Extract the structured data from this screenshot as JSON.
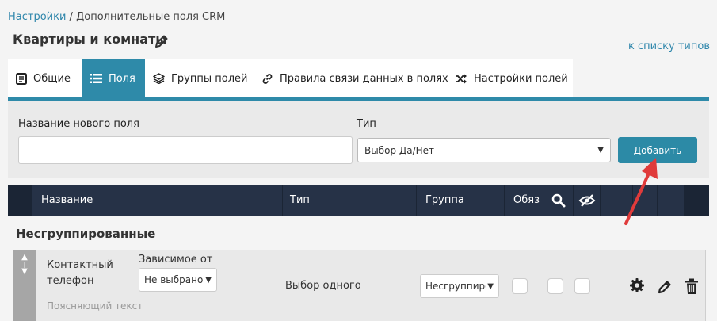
{
  "breadcrumb": {
    "root": "Настройки",
    "separator": " / ",
    "current": "Дополнительные поля CRM"
  },
  "page": {
    "title": "Квартиры и комнаты",
    "back_link": "к списку типов"
  },
  "tabs": [
    {
      "label": "Общие",
      "icon": "document-icon",
      "active": false
    },
    {
      "label": "Поля",
      "icon": "list-icon",
      "active": true
    },
    {
      "label": "Группы полей",
      "icon": "layers-icon",
      "active": false
    },
    {
      "label": "Правила связи данных в полях",
      "icon": "link-icon",
      "active": false
    },
    {
      "label": "Настройки полей",
      "icon": "shuffle-icon",
      "active": false
    }
  ],
  "add_form": {
    "name_label": "Название нового поля",
    "name_value": "",
    "type_label": "Тип",
    "type_value": "Выбор Да/Нет",
    "add_button": "Добавить"
  },
  "table": {
    "headers": {
      "name": "Название",
      "type": "Тип",
      "group": "Группа",
      "required": "Обяз"
    },
    "header_icons": [
      "search-icon",
      "eye-off-icon"
    ]
  },
  "groups": [
    {
      "title": "Несгруппированные",
      "rows": [
        {
          "name": "Контактный телефон",
          "dependent_label": "Зависимое от",
          "dependent_value": "Не выбрано",
          "hint_placeholder": "Поясняющий текст",
          "type": "Выбор одного",
          "group_value": "Несгруппированные"
        }
      ]
    }
  ],
  "colors": {
    "accent": "#2e8aa9",
    "header_bg": "#1b2535",
    "header_cell": "#263247",
    "arrow": "#e03b3b"
  }
}
